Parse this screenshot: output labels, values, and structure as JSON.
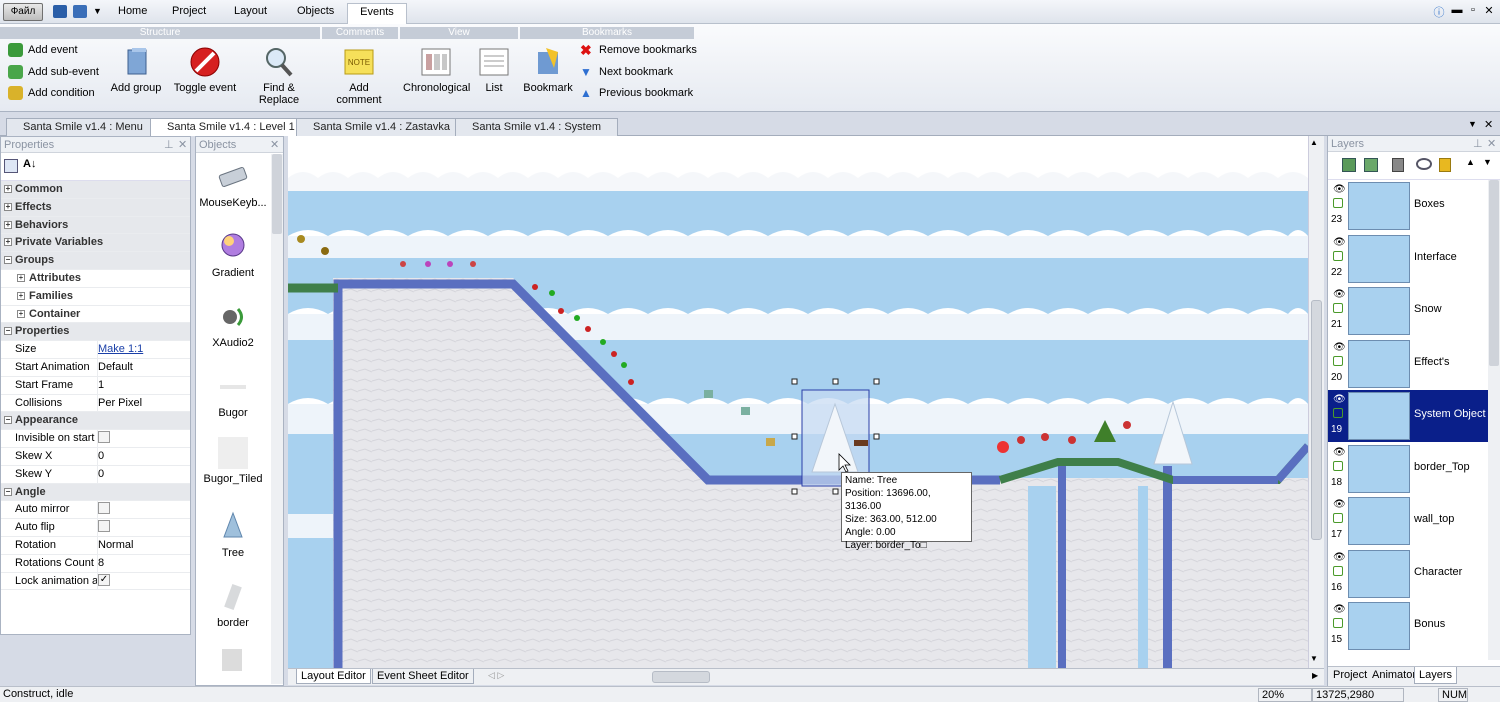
{
  "menubar": {
    "file_label": "Файл",
    "tabs": [
      "Home",
      "Project",
      "Layout",
      "Objects",
      "Events"
    ],
    "active_tab": "Events"
  },
  "ribbon": {
    "groups": [
      "Structure",
      "Comments",
      "View",
      "Bookmarks"
    ],
    "add_event": "Add event",
    "add_sub_event": "Add sub-event",
    "add_condition": "Add condition",
    "add_group": "Add group",
    "toggle_event": "Toggle event",
    "find_replace": "Find & Replace",
    "add_comment": "Add comment",
    "chronological": "Chronological",
    "list": "List",
    "bookmark": "Bookmark",
    "remove_bookmarks": "Remove bookmarks",
    "next_bookmark": "Next bookmark",
    "previous_bookmark": "Previous bookmark",
    "note_icon_text": "NOTE"
  },
  "doc_tabs": [
    "Santa Smile v1.4 : Menu",
    "Santa Smile v1.4 : Level 1",
    "Santa Smile v1.4 : Zastavka",
    "Santa Smile v1.4 : System"
  ],
  "properties": {
    "title": "Properties",
    "rows": [
      {
        "type": "cat",
        "key": "Common"
      },
      {
        "type": "cat",
        "key": "Effects"
      },
      {
        "type": "cat",
        "key": "Behaviors"
      },
      {
        "type": "cat",
        "key": "Private Variables"
      },
      {
        "type": "cat",
        "key": "Groups",
        "open": true
      },
      {
        "type": "sub",
        "key": "Attributes"
      },
      {
        "type": "sub",
        "key": "Families"
      },
      {
        "type": "sub",
        "key": "Container"
      },
      {
        "type": "cat",
        "key": "Properties",
        "open": true
      },
      {
        "type": "kv",
        "key": "Size",
        "value": "Make 1:1",
        "link": true
      },
      {
        "type": "kv",
        "key": "Start Animation",
        "value": "Default"
      },
      {
        "type": "kv",
        "key": "Start Frame",
        "value": "1"
      },
      {
        "type": "kv",
        "key": "Collisions",
        "value": "Per Pixel"
      },
      {
        "type": "cat",
        "key": "Appearance",
        "open": true
      },
      {
        "type": "chk",
        "key": "Invisible on start",
        "value": ""
      },
      {
        "type": "kv",
        "key": "Skew X",
        "value": "0"
      },
      {
        "type": "kv",
        "key": "Skew Y",
        "value": "0"
      },
      {
        "type": "cat",
        "key": "Angle",
        "open": true
      },
      {
        "type": "chk",
        "key": "Auto mirror",
        "value": ""
      },
      {
        "type": "chk",
        "key": "Auto flip",
        "value": ""
      },
      {
        "type": "kv",
        "key": "Rotation",
        "value": "Normal"
      },
      {
        "type": "kv",
        "key": "Rotations Count",
        "value": "8"
      },
      {
        "type": "chk",
        "key": "Lock animation ar",
        "value": "✓"
      }
    ]
  },
  "objects": {
    "title": "Objects",
    "items": [
      "MouseKeyb...",
      "Gradient",
      "XAudio2",
      "Bugor",
      "Bugor_Tiled",
      "Tree",
      "border"
    ]
  },
  "editor_tabs": [
    "Layout Editor",
    "Event Sheet Editor"
  ],
  "tooltip": {
    "name": "Name: Tree",
    "position": "Position: 13696.00, 3136.00",
    "size": "Size: 363.00, 512.00",
    "angle": "Angle: 0.00",
    "layer": "Layer: border_To□"
  },
  "layers": {
    "title": "Layers",
    "items": [
      {
        "name": "Boxes",
        "num": "23"
      },
      {
        "name": "Interface",
        "num": "22"
      },
      {
        "name": "Snow",
        "num": "21"
      },
      {
        "name": "Effect's",
        "num": "20"
      },
      {
        "name": "System Object",
        "num": "19",
        "selected": true
      },
      {
        "name": "border_Top",
        "num": "18"
      },
      {
        "name": "wall_top",
        "num": "17"
      },
      {
        "name": "Character",
        "num": "16"
      },
      {
        "name": "Bonus",
        "num": "15"
      }
    ],
    "bottom_tabs": [
      "Project",
      "Animator",
      "Layers"
    ]
  },
  "status": {
    "text": "Construct, idle",
    "zoom": "20%",
    "coords": "13725,2980",
    "num": "NUM"
  }
}
